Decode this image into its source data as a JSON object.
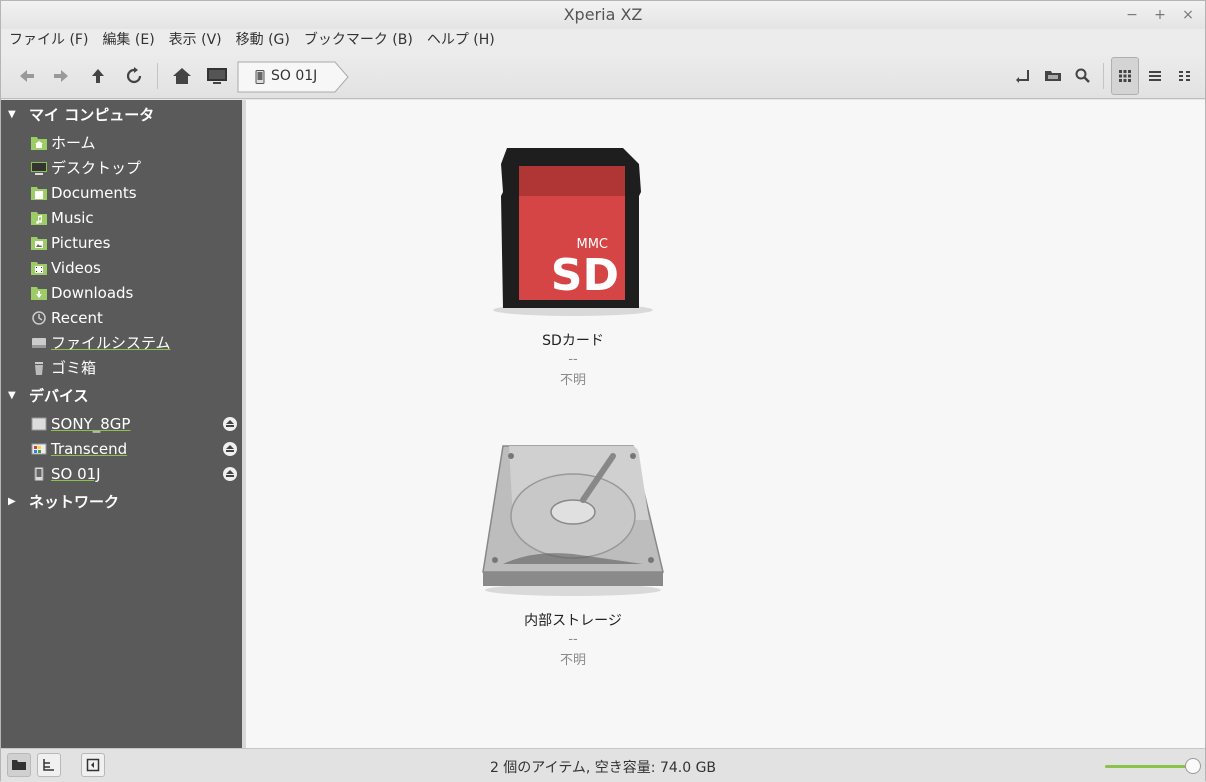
{
  "window": {
    "title": "Xperia XZ",
    "minimize": "−",
    "maximize": "+",
    "close": "×"
  },
  "menubar": {
    "items": [
      "ファイル (F)",
      "編集 (E)",
      "表示 (V)",
      "移動 (G)",
      "ブックマーク (B)",
      "ヘルプ (H)"
    ]
  },
  "toolbar": {
    "breadcrumb": "SO 01J"
  },
  "sidebar": {
    "sections": [
      {
        "label": "マイ コンピュータ",
        "expanded": true
      },
      {
        "label": "デバイス",
        "expanded": true
      },
      {
        "label": "ネットワーク",
        "expanded": false
      }
    ],
    "places": [
      {
        "label": "ホーム",
        "icon": "home-folder-icon"
      },
      {
        "label": "デスクトップ",
        "icon": "desktop-icon"
      },
      {
        "label": "Documents",
        "icon": "folder-icon"
      },
      {
        "label": "Music",
        "icon": "music-folder-icon"
      },
      {
        "label": "Pictures",
        "icon": "pictures-folder-icon"
      },
      {
        "label": "Videos",
        "icon": "videos-folder-icon"
      },
      {
        "label": "Downloads",
        "icon": "downloads-folder-icon"
      },
      {
        "label": "Recent",
        "icon": "recent-icon"
      },
      {
        "label": "ファイルシステム",
        "icon": "drive-icon"
      },
      {
        "label": "ゴミ箱",
        "icon": "trash-icon"
      }
    ],
    "devices": [
      {
        "label": "SONY_8GP",
        "icon": "usb-drive-icon"
      },
      {
        "label": "Transcend",
        "icon": "card-reader-icon"
      },
      {
        "label": "SO 01J",
        "icon": "phone-icon"
      }
    ]
  },
  "main": {
    "items": [
      {
        "name": "SDカード",
        "line1": "--",
        "line2": "不明",
        "icon": "sd-card-icon",
        "card_brand": "MMC",
        "card_label": "SD"
      },
      {
        "name": "内部ストレージ",
        "line1": "--",
        "line2": "不明",
        "icon": "hard-disk-icon"
      }
    ]
  },
  "statusbar": {
    "text": "2 個のアイテム, 空き容量: 74.0 GB",
    "zoom": 1.0
  },
  "colors": {
    "sidebar_bg": "#5a5a5a",
    "accent": "#8bc34a",
    "sd_red": "#d64545"
  }
}
